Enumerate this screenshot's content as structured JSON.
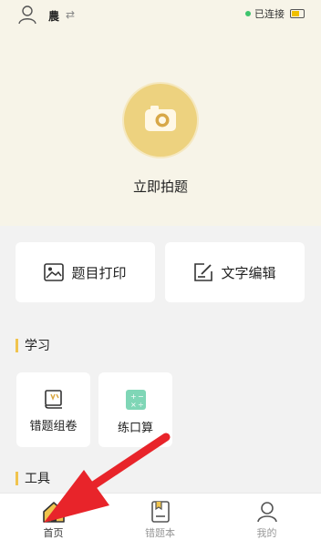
{
  "header": {
    "username": "農",
    "status_text": "已连接",
    "status_color": "#3ec46d",
    "icons": [
      "user-icon",
      "switch-icon",
      "battery-icon"
    ]
  },
  "capture": {
    "label": "立即拍题",
    "icon": "camera-icon",
    "accent": "#edd27f"
  },
  "actions": [
    {
      "label": "题目打印",
      "icon": "image-print-icon"
    },
    {
      "label": "文字编辑",
      "icon": "edit-text-icon"
    }
  ],
  "sections": {
    "study": {
      "title": "学习"
    },
    "tools": {
      "title": "工具"
    }
  },
  "study_items": [
    {
      "label": "错题组卷",
      "icon": "book-icon"
    },
    {
      "label": "练口算",
      "icon": "calculator-icon"
    }
  ],
  "tabbar": {
    "items": [
      {
        "label": "首页",
        "icon": "home-icon",
        "active": true
      },
      {
        "label": "错题本",
        "icon": "notebook-icon",
        "active": false
      },
      {
        "label": "我的",
        "icon": "profile-icon",
        "active": false
      }
    ]
  },
  "annotation": {
    "color": "#e8242a",
    "icon": "red-arrow-icon"
  }
}
